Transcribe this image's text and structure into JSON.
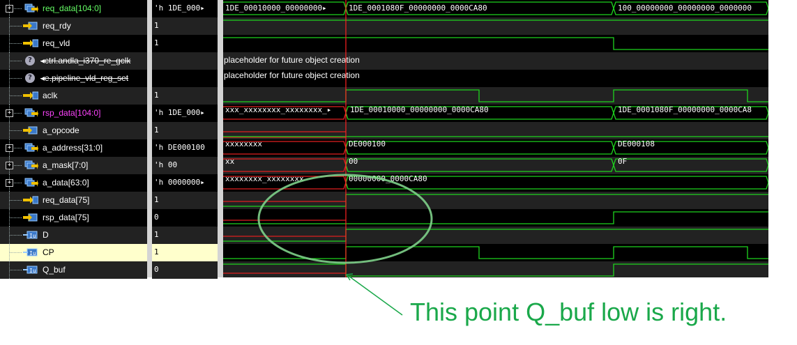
{
  "signals": [
    {
      "name": "req_data[104:0]",
      "value": "'h 1DE_000▸",
      "kind": "bus",
      "color": "grn",
      "expand": "+"
    },
    {
      "name": "req_rdy",
      "value": "1",
      "kind": "in",
      "color": "white"
    },
    {
      "name": "req_vld",
      "value": "1",
      "kind": "out",
      "color": "white"
    },
    {
      "name": "◂ctrl.andla_i370_re_gclk",
      "value": "",
      "kind": "q",
      "color": "white",
      "strike": true
    },
    {
      "name": "◂e.pipeline_vld_reg_set",
      "value": "",
      "kind": "q",
      "color": "white",
      "strike": true
    },
    {
      "name": "aclk",
      "value": "1",
      "kind": "out",
      "color": "white"
    },
    {
      "name": "rsp_data[104:0]",
      "value": "'h 1DE_000▸",
      "kind": "bus",
      "color": "mag",
      "expand": "+"
    },
    {
      "name": "a_opcode",
      "value": "1",
      "kind": "in",
      "color": "white"
    },
    {
      "name": "a_address[31:0]",
      "value": "'h DE000100",
      "kind": "bus",
      "color": "white",
      "expand": "+"
    },
    {
      "name": "a_mask[7:0]",
      "value": "'h 00",
      "kind": "bus",
      "color": "white",
      "expand": "+"
    },
    {
      "name": "a_data[63:0]",
      "value": "'h 0000000▸",
      "kind": "bus",
      "color": "white",
      "expand": "+"
    },
    {
      "name": "req_data[75]",
      "value": "1",
      "kind": "out",
      "color": "white"
    },
    {
      "name": "rsp_data[75]",
      "value": "0",
      "kind": "in",
      "color": "white"
    },
    {
      "name": "D",
      "value": "1",
      "kind": "port",
      "color": "white"
    },
    {
      "name": "CP",
      "value": "1",
      "kind": "port",
      "color": "dark",
      "selected": true
    },
    {
      "name": "Q_buf",
      "value": "0",
      "kind": "port",
      "color": "white"
    }
  ],
  "waves": {
    "req_data_segments": [
      "1DE_00010000_00000000▸",
      "1DE_0001080F_00000000_0000CA80",
      "100_00000000_00000000_0000000"
    ],
    "placeholder_text": "placeholder for future object creation",
    "rsp_data_segments": [
      "xxx_xxxxxxxx_xxxxxxxx_▸",
      "1DE_00010000_00000000_0000CA80",
      "1DE_0001080F_00000000_0000CA8"
    ],
    "a_address_segments": [
      "xxxxxxxx",
      "DE000100",
      "DE000108"
    ],
    "a_mask_segments": [
      "xx",
      "00",
      "0F"
    ],
    "a_data_segments": [
      "xxxxxxxx_xxxxxxxx",
      "00000000_0000CA80"
    ]
  },
  "annotation": "This point Q_buf low is right.",
  "colors": {
    "wave": "#1ed41e",
    "cursor": "#ff2020",
    "xval": "#e02020",
    "annotation": "#1aa84a",
    "selected_row": "#ffffcc"
  }
}
